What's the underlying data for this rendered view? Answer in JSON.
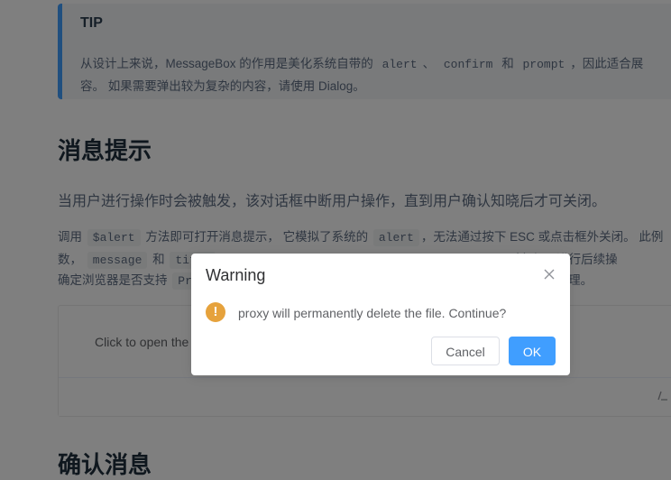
{
  "tip": {
    "title": "TIP",
    "line1_a": "从设计上来说，MessageBox 的作用是美化系统自带的",
    "code1": "alert",
    "sep1": "、",
    "code2": "confirm",
    "sep2": "和",
    "code3": "prompt",
    "line1_b": "，因此适合展",
    "line2": "容。 如果需要弹出较为复杂的内容，请使用 Dialog。"
  },
  "section1": {
    "heading": "消息提示",
    "intro": "当用户进行操作时会被触发，该对话框中断用户操作，直到用户确认知晓后才可关闭。",
    "desc1_a": "调用",
    "desc1_code1": "$alert",
    "desc1_b": "方法即可打开消息提示， 它模拟了系统的",
    "desc1_code2": "alert",
    "desc1_c": "，无法通过按下 ESC 或点击框外关闭。 此例",
    "desc2_a": "数，",
    "desc2_code1": "message",
    "desc2_b": "和",
    "desc2_code2": "title",
    "desc2_c": "对象便于进行后续操",
    "desc3_a": "确定浏览器是否支持",
    "desc3_code": "Pr",
    "desc3_b": "处理。"
  },
  "demo": {
    "button_text": "Click to open the"
  },
  "section2": {
    "heading": "确认消息"
  },
  "dialog": {
    "title": "Warning",
    "message": "proxy will permanently delete the file. Continue?",
    "cancel_label": "Cancel",
    "ok_label": "OK",
    "icon": "warning-icon",
    "icon_glyph": "!"
  },
  "colors": {
    "primary": "#409eff",
    "warning": "#e6a23c",
    "overlay": "rgba(0,0,0,0.5)"
  }
}
